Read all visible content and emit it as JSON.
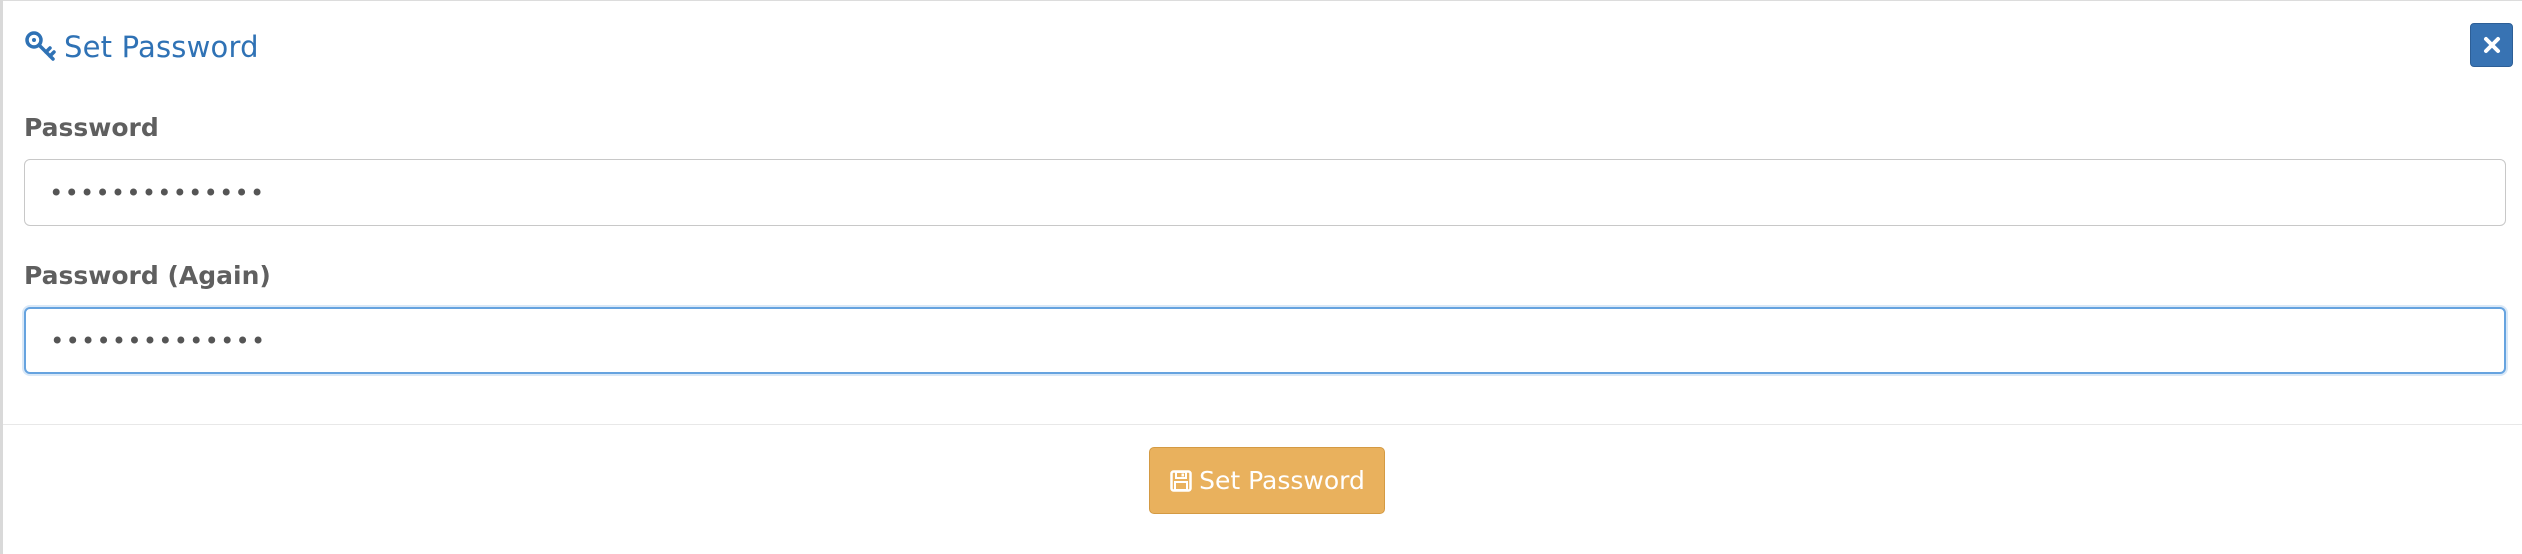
{
  "modal": {
    "title": "Set Password",
    "title_icon": "key-icon",
    "close_icon": "close-icon"
  },
  "form": {
    "password_label": "Password",
    "password_value": "••••••••••••••",
    "password_again_label": "Password (Again)",
    "password_again_value": "••••••••••••••"
  },
  "footer": {
    "submit_label": "Set Password",
    "submit_icon": "save-icon"
  },
  "colors": {
    "accent": "#2f72b5",
    "close_button": "#3873b3",
    "submit_button": "#e9b15d",
    "focus_border": "#66a3df"
  }
}
